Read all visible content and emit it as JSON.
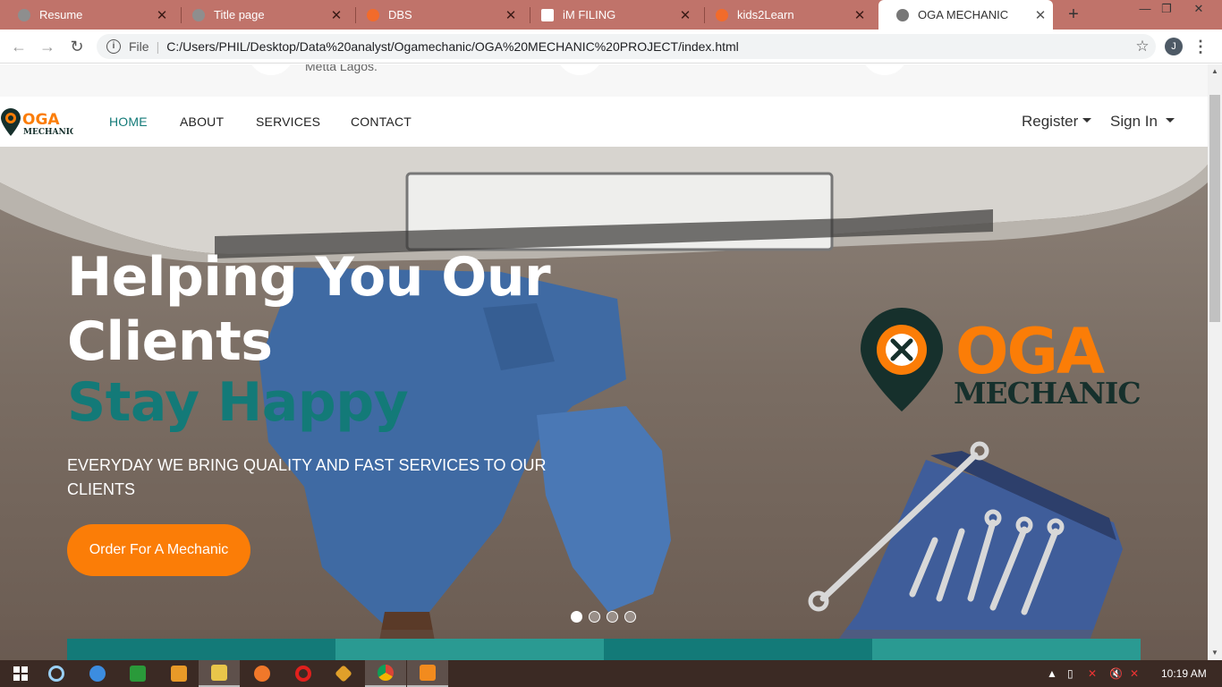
{
  "browser": {
    "tabs": [
      {
        "label": "Resume",
        "icon": "globe-icon"
      },
      {
        "label": "Title page",
        "icon": "globe-icon"
      },
      {
        "label": "DBS",
        "icon": "firefox-swirl-icon"
      },
      {
        "label": "iM FILING",
        "icon": "flag-icon"
      },
      {
        "label": "kids2Learn",
        "icon": "firefox-swirl-icon"
      },
      {
        "label": "OGA MECHANIC",
        "icon": "globe-icon",
        "active": true
      }
    ],
    "address": {
      "scheme_label": "File",
      "url": "C:/Users/PHIL/Desktop/Data%20analyst/Ogamechanic/OGA%20MECHANIC%20PROJECT/index.html"
    },
    "profile_initial": "J"
  },
  "page": {
    "info_strip": {
      "address_fragment": "Metta Lagos."
    },
    "nav": {
      "brand": {
        "word": "OGA",
        "sub": "MECHANIC"
      },
      "links": [
        "HOME",
        "ABOUT",
        "SERVICES",
        "CONTACT"
      ],
      "register_label": "Register",
      "signin_label": "Sign In"
    },
    "hero": {
      "headline_white": "Helping You Our Clients",
      "headline_teal": "Stay Happy",
      "subtext": "EVERYDAY WE BRING QUALITY AND FAST SERVICES TO OUR CLIENTS",
      "cta_label": "Order For A Mechanic",
      "logo": {
        "word": "OGA",
        "sub": "MECHANIC"
      },
      "slides_total": 4,
      "slide_active": 1
    }
  },
  "taskbar": {
    "apps": [
      "windows-start-icon",
      "cortana-icon",
      "ie-icon",
      "store-icon",
      "media-player-icon",
      "file-explorer-icon",
      "firefox-icon",
      "opera-icon",
      "git-icon",
      "chrome-icon",
      "sublime-icon"
    ],
    "clock": "10:19 AM"
  },
  "colors": {
    "tabstrip": "#c0736a",
    "brand_orange": "#fb7d07",
    "brand_teal": "#137a78",
    "brand_dark": "#16302c"
  }
}
